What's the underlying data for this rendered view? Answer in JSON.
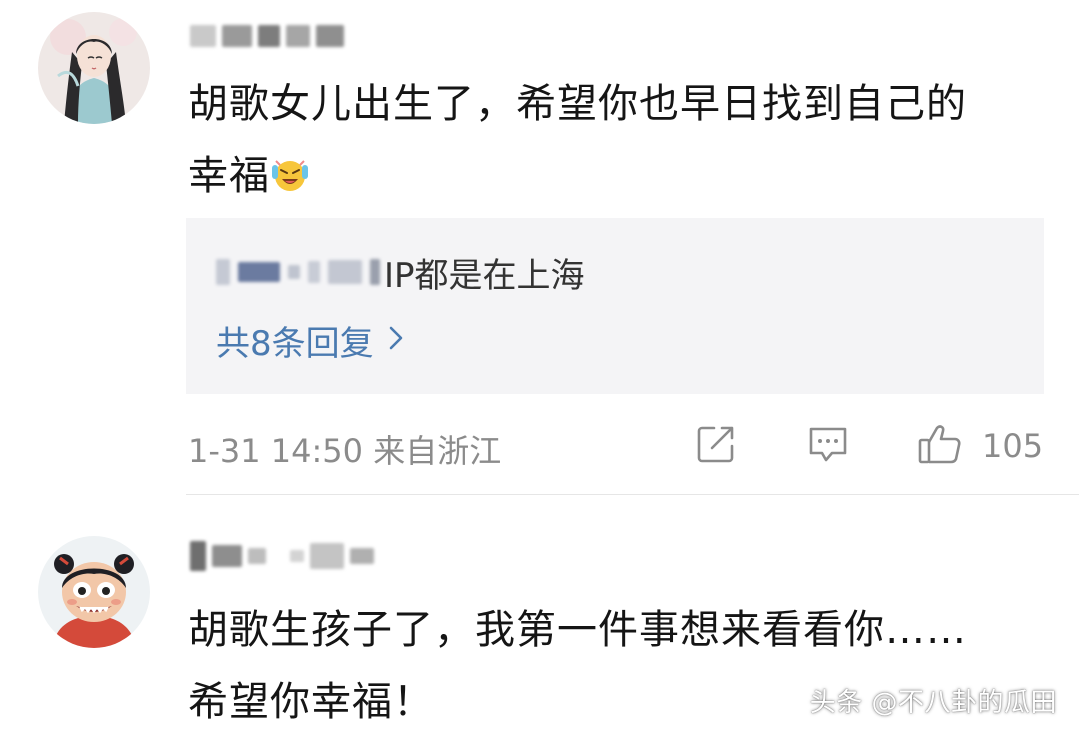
{
  "comments": [
    {
      "text_line1": "胡歌女儿出生了，希望你也早日找到自己的",
      "text_line2": "幸福",
      "emoji": "laughing-crying-emoji",
      "reply": {
        "snippet": "IP都是在上海",
        "count_label": "共8条回复"
      },
      "meta": {
        "timestamp": "1-31 14:50",
        "location": "来自浙江",
        "likes": "105"
      }
    },
    {
      "text_line1": "胡歌生孩子了，我第一件事想来看看你……",
      "text_line2": "希望你幸福！"
    }
  ],
  "icons": {
    "share": "share-edit-icon",
    "comment": "comment-bubble-icon",
    "like": "thumbs-up-icon",
    "reply_more": "chevron-right-icon"
  },
  "colors": {
    "reply_link": "#4a7ab0",
    "meta_gray": "#8b8b8b",
    "reply_bg": "#f4f4f6"
  },
  "watermark": "头条 @不八卦的瓜田"
}
